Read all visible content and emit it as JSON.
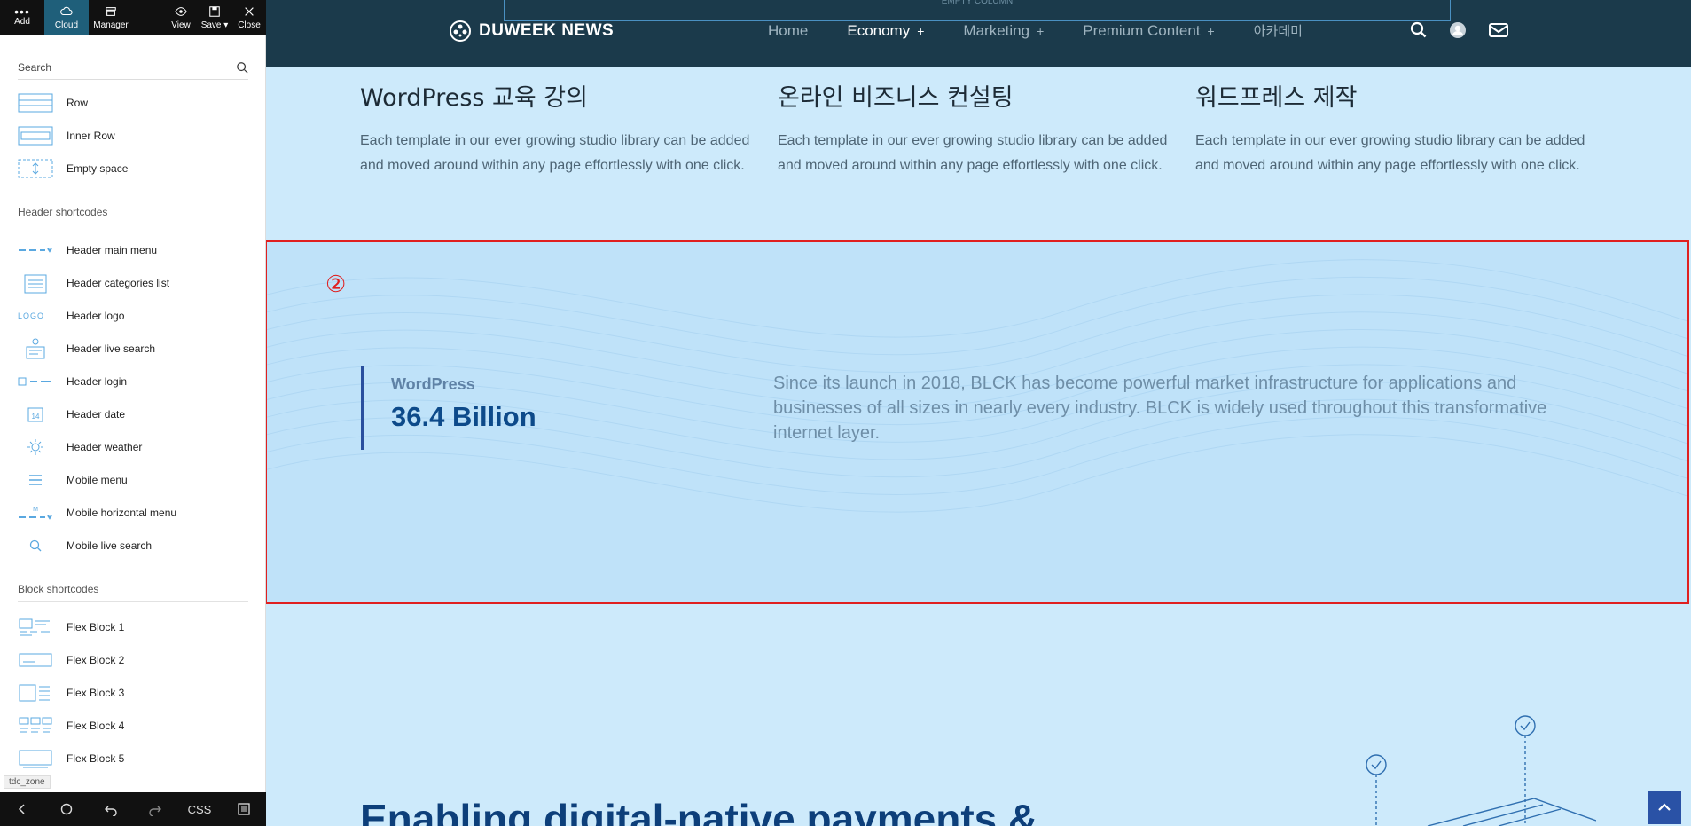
{
  "toolbar": {
    "add": "Add",
    "cloud": "Cloud",
    "manager": "Manager",
    "view": "View",
    "save": "Save",
    "close": "Close"
  },
  "search": {
    "placeholder": "Search"
  },
  "elements": {
    "row": "Row",
    "inner_row": "Inner Row",
    "empty_space": "Empty space"
  },
  "header_section": {
    "title": "Header shortcodes",
    "items": [
      "Header main menu",
      "Header categories list",
      "Header logo",
      "Header live search",
      "Header login",
      "Header date",
      "Header weather",
      "Mobile menu",
      "Mobile horizontal menu",
      "Mobile live search"
    ]
  },
  "block_section": {
    "title": "Block shortcodes",
    "items": [
      "Flex Block 1",
      "Flex Block 2",
      "Flex Block 3",
      "Flex Block 4",
      "Flex Block 5"
    ]
  },
  "zone_tag": "tdc_zone",
  "bottombar": {
    "css": "CSS"
  },
  "site": {
    "empty_column": "EMPTY COLUMN",
    "logo": "DUWEEK NEWS",
    "nav": [
      "Home",
      "Economy",
      "Marketing",
      "Premium Content",
      "아카데미"
    ],
    "features": [
      {
        "title": "WordPress 교육 강의",
        "desc": "Each template in our ever growing studio library can be added and moved around within any page effortlessly with one click."
      },
      {
        "title": "온라인 비즈니스 컨설팅",
        "desc": "Each template in our ever growing studio library can be added and moved around within any page effortlessly with one click."
      },
      {
        "title": "워드프레스 제작",
        "desc": "Each template in our ever growing studio library can be added and moved around within any page effortlessly with one click."
      }
    ],
    "marker": "②",
    "stat_label": "WordPress",
    "stat_value": "36.4 Billion",
    "stat_desc": "Since its launch in 2018, BLCK has become powerful market infrastructure for applications and businesses of all sizes in nearly every industry. BLCK is widely used throughout this transformative internet layer.",
    "big_title": "Enabling digital-native payments &"
  },
  "colors": {
    "canvas_bg": "#cdeafb",
    "header_bg": "#1b3a4b",
    "accent_blue": "#0d4a8a",
    "selection_red": "#e02020"
  }
}
